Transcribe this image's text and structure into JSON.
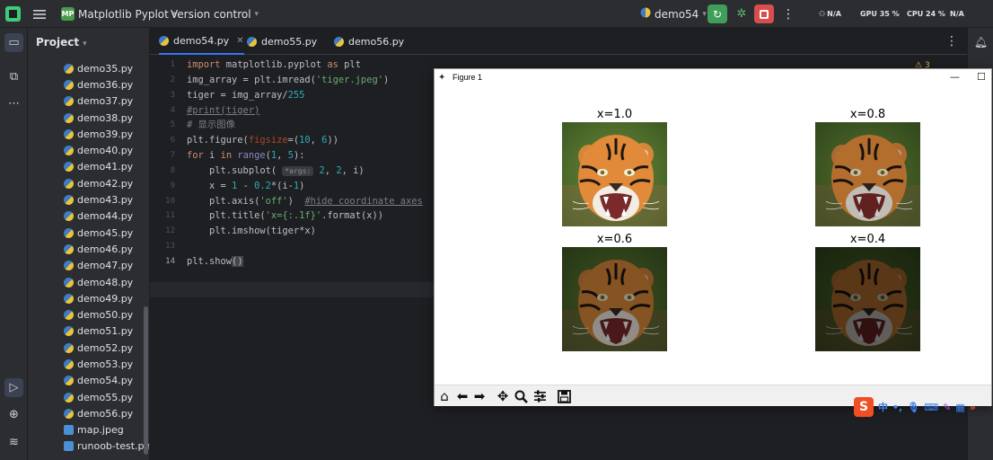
{
  "titlebar": {
    "project_badge": "MP",
    "project_name": "Matplotlib Pyplot",
    "version_control": "Version control",
    "run_target": "demo54",
    "stats": [
      "N/A",
      "GPU 35 %",
      "CPU 24 %",
      "N/A"
    ]
  },
  "project_panel": {
    "header": "Project",
    "files": [
      {
        "name": "demo35.py",
        "type": "py"
      },
      {
        "name": "demo36.py",
        "type": "py"
      },
      {
        "name": "demo37.py",
        "type": "py"
      },
      {
        "name": "demo38.py",
        "type": "py"
      },
      {
        "name": "demo39.py",
        "type": "py"
      },
      {
        "name": "demo40.py",
        "type": "py"
      },
      {
        "name": "demo41.py",
        "type": "py"
      },
      {
        "name": "demo42.py",
        "type": "py"
      },
      {
        "name": "demo43.py",
        "type": "py"
      },
      {
        "name": "demo44.py",
        "type": "py"
      },
      {
        "name": "demo45.py",
        "type": "py"
      },
      {
        "name": "demo46.py",
        "type": "py"
      },
      {
        "name": "demo47.py",
        "type": "py"
      },
      {
        "name": "demo48.py",
        "type": "py"
      },
      {
        "name": "demo49.py",
        "type": "py"
      },
      {
        "name": "demo50.py",
        "type": "py"
      },
      {
        "name": "demo51.py",
        "type": "py"
      },
      {
        "name": "demo52.py",
        "type": "py"
      },
      {
        "name": "demo53.py",
        "type": "py"
      },
      {
        "name": "demo54.py",
        "type": "py"
      },
      {
        "name": "demo55.py",
        "type": "py"
      },
      {
        "name": "demo56.py",
        "type": "py"
      },
      {
        "name": "map.jpeg",
        "type": "img"
      },
      {
        "name": "runoob-test.png",
        "type": "img"
      }
    ]
  },
  "editor": {
    "tabs": [
      {
        "label": "demo54.py",
        "active": true
      },
      {
        "label": "demo55.py",
        "active": false
      },
      {
        "label": "demo56.py",
        "active": false
      }
    ],
    "current_line": 14,
    "inspection_count": "3",
    "lines": [
      "import matplotlib.pyplot as plt",
      "img_array = plt.imread('tiger.jpeg')",
      "tiger = img_array/255",
      "#print(tiger)",
      "# 显示图像",
      "plt.figure(figsize=(10, 6))",
      "for i in range(1, 5):",
      "    plt.subplot( *args: 2, 2, i)",
      "    x = 1 - 0.2*(i-1)",
      "    plt.axis('off')  #hide coordinate axes",
      "    plt.title('x={:.1f}'.format(x))",
      "    plt.imshow(tiger*x)",
      "",
      "plt.show()"
    ]
  },
  "figure_window": {
    "title": "Figure 1",
    "subplots": [
      {
        "title": "x=1.0",
        "brightness": 1.0
      },
      {
        "title": "x=0.8",
        "brightness": 0.8
      },
      {
        "title": "x=0.6",
        "brightness": 0.6
      },
      {
        "title": "x=0.4",
        "brightness": 0.4
      }
    ],
    "toolbar": [
      "home-icon",
      "back-icon",
      "forward-icon",
      "pan-icon",
      "zoom-icon",
      "configure-icon",
      "save-icon"
    ]
  },
  "ime": {
    "lang": "中"
  },
  "colors": {
    "accent": "#3574f0",
    "run": "#3f9f5a",
    "stop": "#d94d4d"
  }
}
